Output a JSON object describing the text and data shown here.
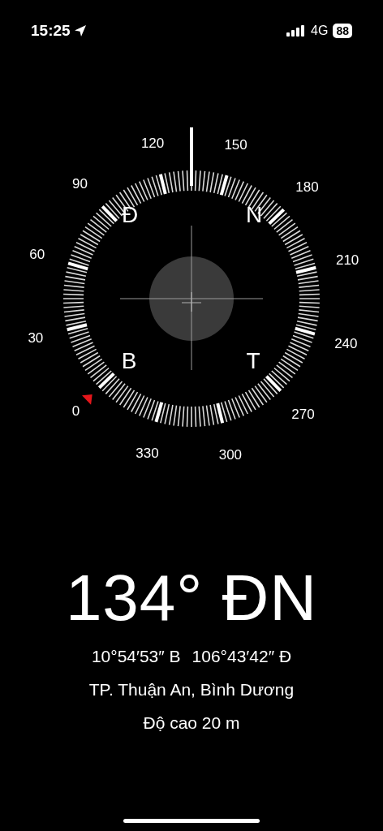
{
  "status_bar": {
    "time": "15:25",
    "network": "4G",
    "battery": "88"
  },
  "compass": {
    "degree_labels": [
      "0",
      "30",
      "60",
      "90",
      "120",
      "150",
      "180",
      "210",
      "240",
      "270",
      "300",
      "330"
    ],
    "cardinals": [
      "Đ",
      "N",
      "B",
      "T"
    ]
  },
  "heading": "134° ĐN",
  "coordinates": [
    "10°54′53″ B",
    "106°43′42″ Đ"
  ],
  "location": "TP. Thuận An, Bình Dương",
  "elevation": "Độ cao 20 m"
}
